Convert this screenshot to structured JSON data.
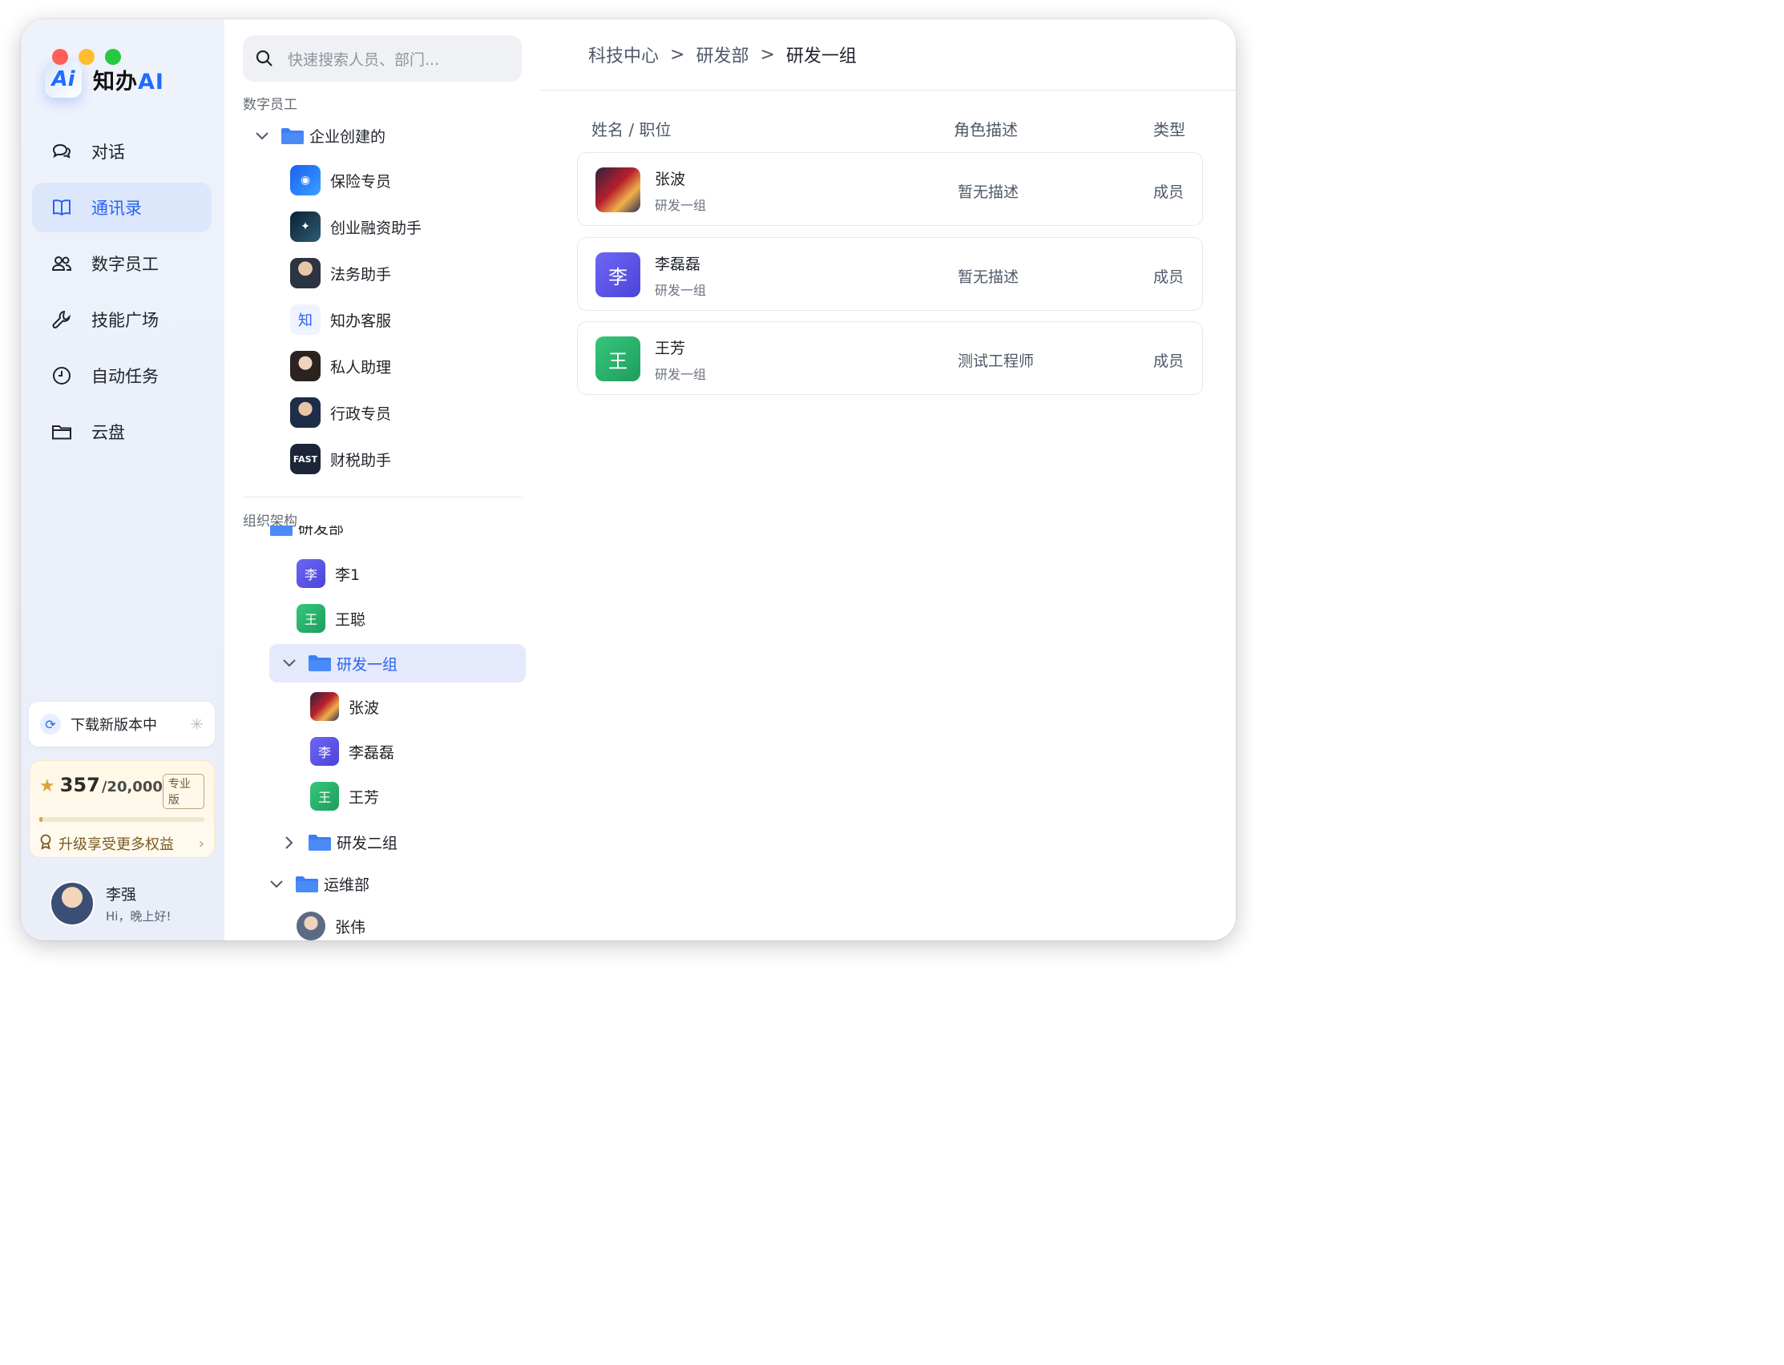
{
  "brand": {
    "name": "知办",
    "name_ai": "AI"
  },
  "nav": [
    {
      "label": "对话",
      "icon": "chat-icon"
    },
    {
      "label": "通讯录",
      "icon": "book-icon",
      "active": true
    },
    {
      "label": "数字员工",
      "icon": "users-icon"
    },
    {
      "label": "技能广场",
      "icon": "wrench-icon"
    },
    {
      "label": "自动任务",
      "icon": "clock-icon"
    },
    {
      "label": "云盘",
      "icon": "folder-icon"
    }
  ],
  "update": {
    "label": "下载新版本中"
  },
  "points": {
    "value": "357",
    "total": "/20,000",
    "plan": "专业版",
    "progress": 0.018,
    "upgrade": "升级享受更多权益"
  },
  "user": {
    "name": "李强",
    "greeting": "Hi，晚上好!"
  },
  "search": {
    "placeholder": "快速搜索人员、部门..."
  },
  "digital_section": {
    "title": "数字员工",
    "folder": "企业创建的",
    "agents": [
      "保险专员",
      "创业融资助手",
      "法务助手",
      "知办客服",
      "私人助理",
      "行政专员",
      "财税助手"
    ],
    "agent_badges": {
      "kefu": "知",
      "fast": "FAST"
    }
  },
  "org_section": {
    "title": "组织架构",
    "dept_partial": "研发部",
    "members_top": [
      {
        "initial": "李",
        "name": "李1"
      },
      {
        "initial": "王",
        "name": "王聪"
      }
    ],
    "group1": "研发一组",
    "group1_members": [
      {
        "initial": "",
        "name": "张波"
      },
      {
        "initial": "李",
        "name": "李磊磊"
      },
      {
        "initial": "王",
        "name": "王芳"
      }
    ],
    "group2": "研发二组",
    "ops_dept": "运维部",
    "ops_members": [
      {
        "name": "张伟"
      }
    ]
  },
  "breadcrumb": [
    "科技中心",
    "研发部",
    "研发一组"
  ],
  "breadcrumb_sep": ">",
  "table": {
    "headers": {
      "name": "姓名 / 职位",
      "desc": "角色描述",
      "type": "类型"
    },
    "rows": [
      {
        "initial": "",
        "name": "张波",
        "dept": "研发一组",
        "desc": "暂无描述",
        "type": "成员"
      },
      {
        "initial": "李",
        "name": "李磊磊",
        "dept": "研发一组",
        "desc": "暂无描述",
        "type": "成员"
      },
      {
        "initial": "王",
        "name": "王芳",
        "dept": "研发一组",
        "desc": "测试工程师",
        "type": "成员"
      }
    ]
  }
}
